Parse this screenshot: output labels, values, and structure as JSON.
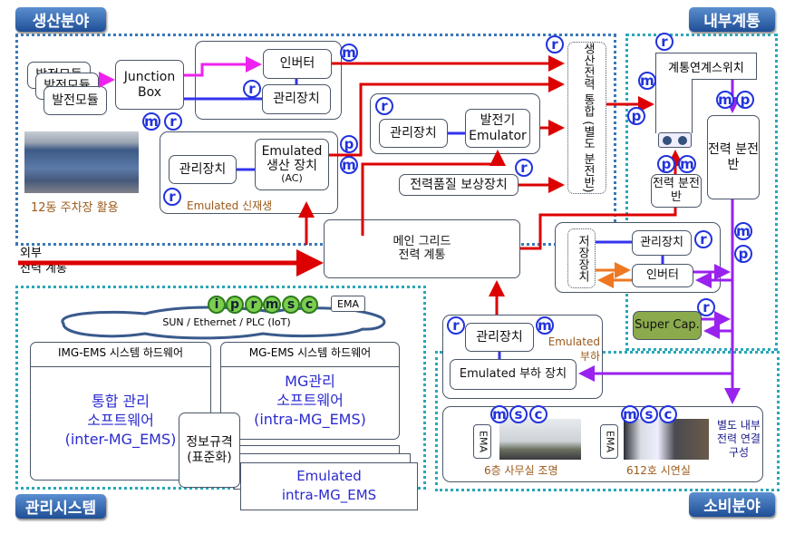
{
  "sections": {
    "production": "생산분야",
    "internal": "내부계통",
    "management": "관리시스템",
    "consumption": "소비분야"
  },
  "production": {
    "modules": [
      "발전모듈",
      "발전모듈",
      "발전모듈"
    ],
    "junction_box": "Junction Box",
    "inverter": "인버터",
    "inverter_manager": "관리장치",
    "photo_caption": "12동 주차장 활용",
    "emulated_renewable": {
      "label": "Emulated 신재생",
      "manager": "관리장치",
      "device_line1": "Emulated",
      "device_line2": "생산 장치",
      "device_line3": "(AC)"
    },
    "generator": {
      "manager": "관리장치",
      "emulator_line1": "발전기",
      "emulator_line2": "Emulator"
    },
    "power_quality": "전력품질 보상장치",
    "integration": "생산전력 통합 (별도 분전반)"
  },
  "internal": {
    "grid_switch": "계통연계스위치",
    "panel_main": "전력 분전반",
    "panel_small": "전력 분전반"
  },
  "main_grid": {
    "line1": "메인 그리드",
    "line2": "전력 계통"
  },
  "external": {
    "line1": "외부",
    "line2": "전력 계통"
  },
  "storage": {
    "device": "저장장치",
    "manager": "관리장치",
    "inverter": "인버터",
    "supercap": "Super Cap."
  },
  "load": {
    "manager": "관리장치",
    "label": "Emulated 부하",
    "device": "Emulated 부하 장치"
  },
  "consumption": {
    "ema": "EMA",
    "site1": "6층 사무실 조명",
    "site2": "612호 시연실",
    "note": "별도 내부 전력 연결 구성"
  },
  "management": {
    "badges": [
      "i",
      "p",
      "r",
      "m",
      "s",
      "c"
    ],
    "ema": "EMA",
    "network": "SUN / Ethernet / PLC (IoT)",
    "img_header": "IMG-EMS 시스템 하드웨어",
    "img_sw": [
      "통합 관리",
      "소프트웨어",
      "(inter-MG_EMS)"
    ],
    "mg_header": "MG-EMS 시스템 하드웨어",
    "mg_sw": [
      "MG관리",
      "소프트웨어",
      "(intra-MG_EMS)"
    ],
    "standard": [
      "정보규격",
      "(표준화)"
    ],
    "emulated": [
      "Emulated",
      "intra-MG_EMS"
    ]
  },
  "colors": {
    "power": "#dd0000",
    "data": "#3333ee",
    "dc": "#ee22ee",
    "internal": "#9922ee",
    "storage": "#ee7722",
    "supercap": "#8aaa4c"
  }
}
